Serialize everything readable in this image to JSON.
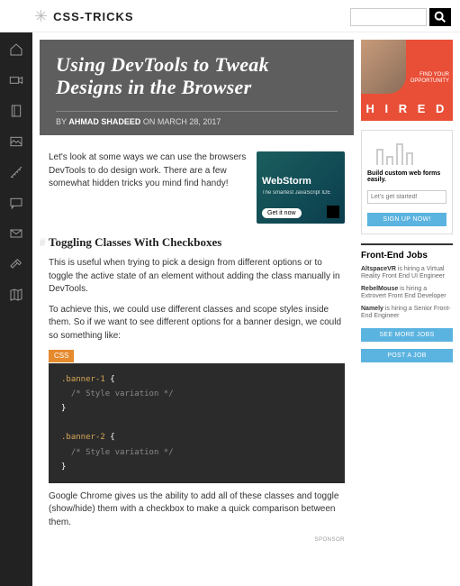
{
  "header": {
    "site_name": "CSS-TRICKS",
    "search_placeholder": ""
  },
  "nav": {
    "items": [
      "home",
      "video",
      "book",
      "image",
      "tools",
      "comment",
      "mail",
      "hammer",
      "map"
    ]
  },
  "article": {
    "title": "Using DevTools to Tweak Designs in the Browser",
    "byline_prefix": "BY ",
    "author": "AHMAD SHADEED",
    "byline_date": " ON MARCH 28, 2017",
    "intro": "Let's look at some ways we can use the browsers DevTools to do design work. There are a few somewhat hidden tricks you mind find handy!",
    "section_h": "Toggling Classes With Checkboxes",
    "p1": "This is useful when trying to pick a design from different options or to toggle the active state of an element without adding the class manually in DevTools.",
    "p2": "To achieve this, we could use different classes and scope styles inside them. So if we want to see different options for a banner design, we could so something like:",
    "p3": "Google Chrome gives us the ability to add all of these classes and toggle (show/hide) them with a checkbox to make a quick comparison between them.",
    "code_lang": "CSS",
    "code": {
      "sel1": ".banner-1",
      "sel2": ".banner-2",
      "com": "/* Style variation */"
    },
    "sponsor_label": "SPONSOR"
  },
  "ads": {
    "webstorm": {
      "title": "WebStorm",
      "sub": "The smartest JavaScript IDE",
      "cta": "Get it now"
    },
    "hired": {
      "tag_line1": "FIND YOUR",
      "tag_line2": "OPPORTUNITY",
      "logo": "H I R E D"
    }
  },
  "forms_widget": {
    "title": "Build custom web forms easily.",
    "placeholder": "Let's get started!",
    "cta": "SIGN UP NOW!"
  },
  "jobs": {
    "heading": "Front-End Jobs",
    "list": [
      {
        "company": "AltspaceVR",
        "rest": " is hiring a Virtual Reality Front End UI Engineer"
      },
      {
        "company": "RebelMouse",
        "rest": " is hiring a Extrovert Front End Developer"
      },
      {
        "company": "Namely",
        "rest": " is hiring a Senior Front-End Engineer"
      }
    ],
    "see_more": "SEE MORE JOBS",
    "post": "POST A JOB"
  }
}
